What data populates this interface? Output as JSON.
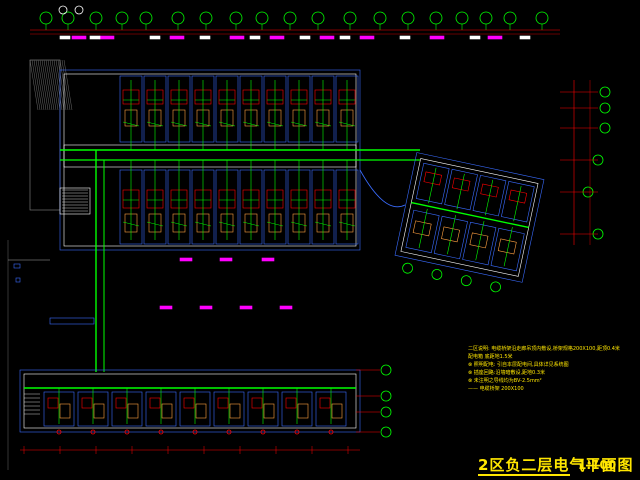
{
  "drawing": {
    "title": "2区负二层电气平面图",
    "scale": "1:100"
  },
  "colors": {
    "background": "#000000",
    "wiring": "#00ff00",
    "walls": "#ffffff",
    "axis": "#00ff00",
    "dimension": "#ff0000",
    "highlight": "#ff00ff",
    "room_walls": "#3a6cff",
    "text": "#ffe600"
  },
  "notes": [
    "二区说明: 电缆桥架沿走廊吊顶内敷设,桥架规格200X100,距顶0.4米",
    "配电箱 底距地1.5米",
    "⊗ 照明配电: 引自本层配电间,具体详见系统图",
    "⊗ 插座回路:沿墙暗敷设,距地0.3米",
    "⊗ 未注明之导线均为BV-2.5mm²",
    "—— 电缆桥架 200X100"
  ]
}
